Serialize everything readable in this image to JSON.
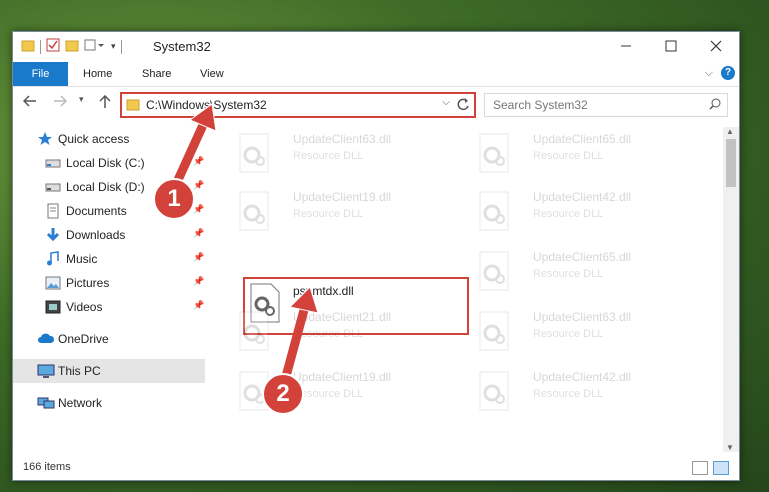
{
  "window": {
    "title": "System32",
    "controls": [
      "minimize",
      "maximize",
      "close"
    ]
  },
  "ribbon": {
    "tabs": [
      "File",
      "Home",
      "Share",
      "View"
    ],
    "expand_icon": "chevron-down-icon",
    "help_label": "?"
  },
  "address": {
    "path": "C:\\Windows\\System32",
    "search_placeholder": "Search System32"
  },
  "sidebar": {
    "items": [
      {
        "label": "Quick access",
        "icon": "star-icon",
        "pinned": false
      },
      {
        "label": "Local Disk (C:)",
        "icon": "drive-icon",
        "pinned": true
      },
      {
        "label": "Local Disk (D:)",
        "icon": "drive-icon",
        "pinned": true
      },
      {
        "label": "Documents",
        "icon": "documents-icon",
        "pinned": true
      },
      {
        "label": "Downloads",
        "icon": "downloads-icon",
        "pinned": true
      },
      {
        "label": "Music",
        "icon": "music-icon",
        "pinned": true
      },
      {
        "label": "Pictures",
        "icon": "pictures-icon",
        "pinned": true
      },
      {
        "label": "Videos",
        "icon": "videos-icon",
        "pinned": true
      },
      {
        "label": "OneDrive",
        "icon": "cloud-icon",
        "pinned": false
      },
      {
        "label": "This PC",
        "icon": "computer-icon",
        "pinned": false,
        "selected": true
      },
      {
        "label": "Network",
        "icon": "network-icon",
        "pinned": false
      }
    ]
  },
  "files": [
    {
      "name": "UpdateClient63.dll",
      "type": "Resource DLL"
    },
    {
      "name": "UpdateClient65.dll",
      "type": "Resource DLL"
    },
    {
      "name": "UpdateClient19.dll",
      "type": "Resource DLL"
    },
    {
      "name": "UpdateClient42.dll",
      "type": "Resource DLL"
    },
    {
      "name": "pspmtdx.dll",
      "type": ""
    },
    {
      "name": "UpdateClient65.dll",
      "type": "Resource DLL"
    },
    {
      "name": "UpdateClient21.dll",
      "type": "Resource DLL"
    },
    {
      "name": "UpdateClient63.dll",
      "type": "Resource DLL"
    },
    {
      "name": "UpdateClient19.dll",
      "type": "Resource DLL"
    },
    {
      "name": "UpdateClient42.dll",
      "type": "Resource DLL"
    }
  ],
  "status": {
    "item_count": "166 items"
  },
  "callouts": [
    "1",
    "2"
  ],
  "colors": {
    "accent": "#1979ca",
    "highlight": "#d2423a"
  }
}
